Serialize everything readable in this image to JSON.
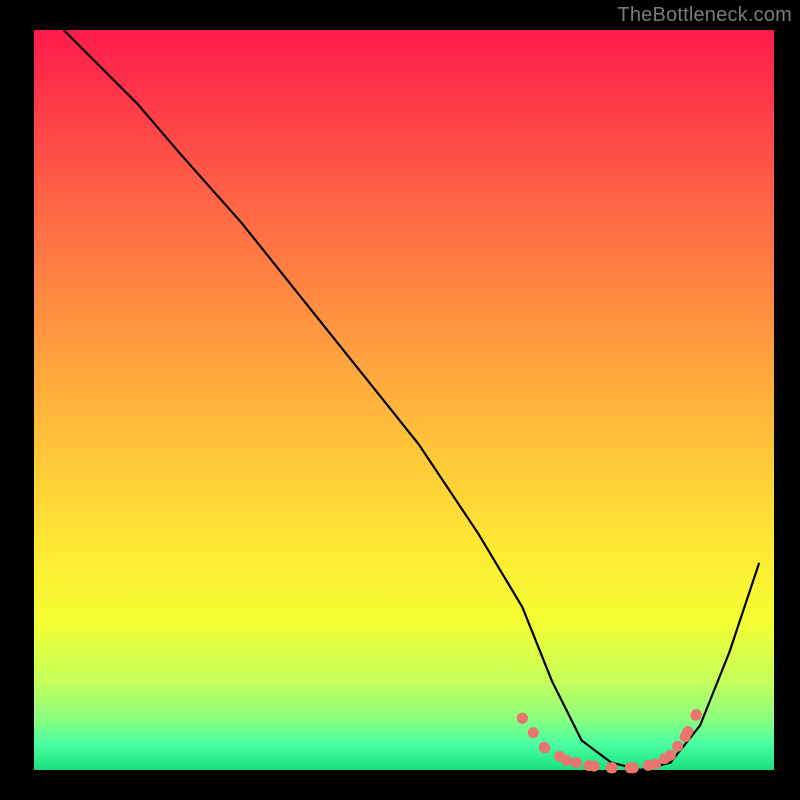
{
  "watermark": "TheBottleneck.com",
  "colors": {
    "frame": "#000000",
    "watermark": "#7a7a7a",
    "curve": "#000000",
    "dots": "#e9766e",
    "gradient_stops": [
      {
        "offset": 0.0,
        "color": "#ff1b4b"
      },
      {
        "offset": 0.1,
        "color": "#ff3a49"
      },
      {
        "offset": 0.25,
        "color": "#ff6a45"
      },
      {
        "offset": 0.4,
        "color": "#ff9540"
      },
      {
        "offset": 0.55,
        "color": "#ffc03a"
      },
      {
        "offset": 0.7,
        "color": "#ffe934"
      },
      {
        "offset": 0.8,
        "color": "#f4ff33"
      },
      {
        "offset": 0.88,
        "color": "#c4ff5a"
      },
      {
        "offset": 0.93,
        "color": "#8cff7d"
      },
      {
        "offset": 0.965,
        "color": "#4bffa2"
      },
      {
        "offset": 1.0,
        "color": "#18e07e"
      }
    ]
  },
  "chart_data": {
    "type": "line",
    "title": "",
    "xlabel": "",
    "ylabel": "",
    "xlim": [
      0,
      100
    ],
    "ylim": [
      0,
      100
    ],
    "note": "Axes are unlabeled; x/y are normalized 0–100 to plot area. Curve shows a V-shaped bottleneck line dropping from top-left to a flat minimum near x≈70–85, then rising toward the right edge.",
    "series": [
      {
        "name": "curve",
        "x": [
          4,
          8,
          14,
          20,
          28,
          36,
          44,
          52,
          60,
          66,
          70,
          74,
          78,
          82,
          86,
          90,
          94,
          98
        ],
        "y": [
          100,
          96,
          90,
          83,
          74,
          64,
          54,
          44,
          32,
          22,
          12,
          4,
          1,
          0,
          1,
          6,
          16,
          28
        ]
      }
    ],
    "flat_region": {
      "note": "Thicker pink dotted segment tracing the valley bottom.",
      "x": [
        66,
        69,
        72,
        75,
        78,
        81,
        84,
        86,
        88,
        89.5
      ],
      "y": [
        7,
        3,
        1.3,
        0.6,
        0.3,
        0.3,
        0.8,
        2,
        4.5,
        7.5
      ]
    }
  }
}
